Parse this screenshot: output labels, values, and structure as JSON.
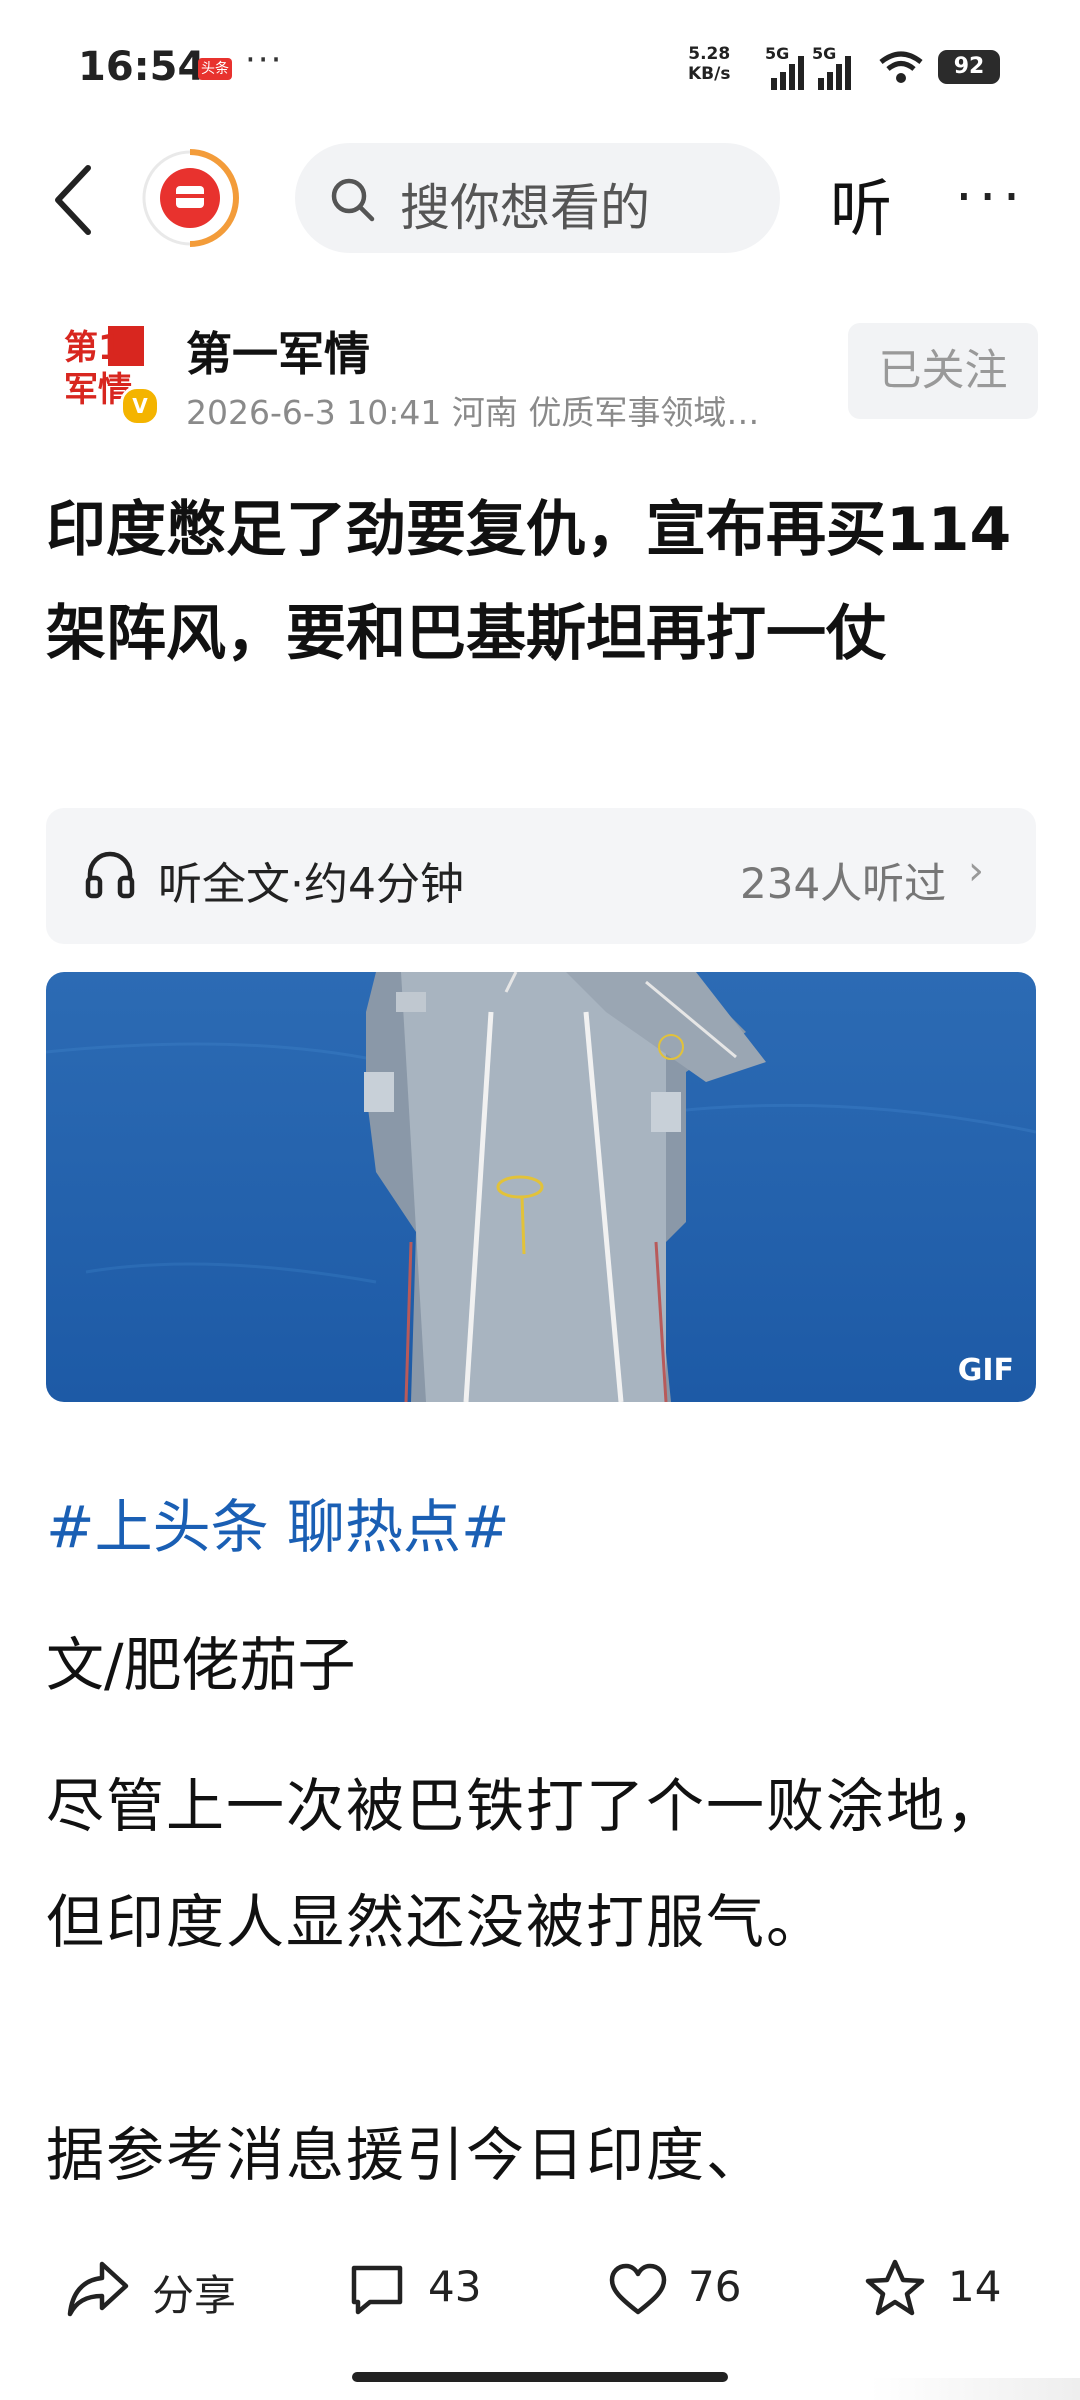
{
  "status_bar": {
    "time": "16:54",
    "app_badge": "头条",
    "more_dots": "···",
    "net_speed_value": "5.28",
    "net_speed_unit": "KB/s",
    "sig1": "5G",
    "sig2": "5G",
    "battery": "92"
  },
  "nav": {
    "search_placeholder": "搜你想看的",
    "listen_label": "听",
    "more_label": "···"
  },
  "author": {
    "name": "第一军情",
    "date": "2026-6-3",
    "time": "10:41",
    "location": "河南",
    "tag": "优质军事领域…",
    "follow_label": "已关注",
    "avatar_text_top": "第1",
    "avatar_text_bottom": "军情",
    "verified_mark": "V"
  },
  "article": {
    "title": "印度憋足了劲要复仇，宣布再买114架阵风，要和巴基斯坦再打一仗",
    "listen_full": "听全文·约4分钟",
    "listen_count": "234人听过",
    "image_badge": "GIF",
    "hashtag": "#上头条 聊热点#",
    "byline": "文/肥佬茄子",
    "paragraph_1": "尽管上一次被巴铁打了个一败涂地，但印度人显然还没被打服气。",
    "paragraph_2": "据参考消息援引今日印度、"
  },
  "bottom_bar": {
    "share_label": "分享",
    "comments": "43",
    "likes": "76",
    "favorites": "14"
  },
  "colors": {
    "brand_red": "#e8322e",
    "hashtag_blue": "#1a5fb4",
    "muted_gray": "#8a8a8a"
  }
}
